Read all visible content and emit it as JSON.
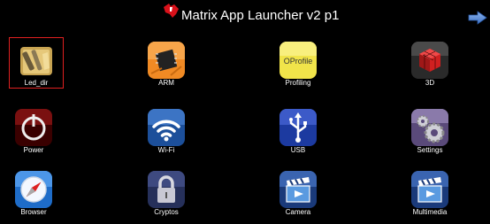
{
  "header": {
    "title": "Matrix App Launcher v2 p1"
  },
  "apps": [
    {
      "label": "Led_dir",
      "icon": "folder-pencil-icon"
    },
    {
      "label": "ARM",
      "icon": "chip-icon"
    },
    {
      "label": "Profiling",
      "icon": "profile-box-icon",
      "icon_text": "OProfile"
    },
    {
      "label": "3D",
      "icon": "cube-icon"
    },
    {
      "label": "Power",
      "icon": "power-icon"
    },
    {
      "label": "Wi-Fi",
      "icon": "wifi-icon"
    },
    {
      "label": "USB",
      "icon": "usb-icon"
    },
    {
      "label": "Settings",
      "icon": "gears-icon"
    },
    {
      "label": "Browser",
      "icon": "compass-icon"
    },
    {
      "label": "Cryptos",
      "icon": "padlock-icon"
    },
    {
      "label": "Camera",
      "icon": "clapperboard-icon"
    },
    {
      "label": "Multimedia",
      "icon": "clapperboard-icon"
    }
  ],
  "selected_app": "Led_dir",
  "colors": {
    "background": "#000000",
    "selection_border": "#e02020",
    "arrow": "#5b8fd6"
  }
}
